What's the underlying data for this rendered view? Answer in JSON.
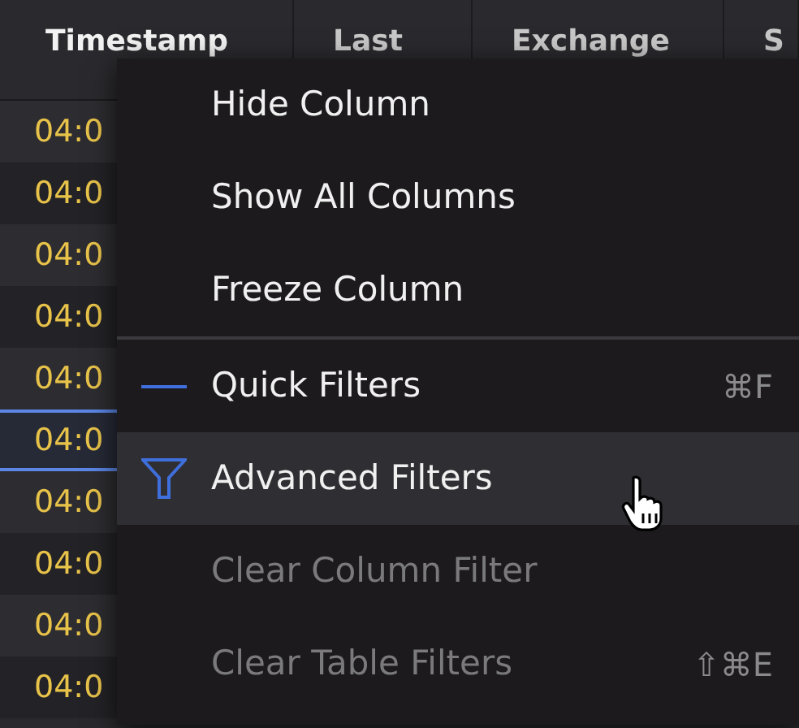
{
  "table": {
    "columns": [
      "Timestamp",
      "Last",
      "Exchange",
      "S"
    ],
    "rows": [
      {
        "time": "04:0",
        "selected": false
      },
      {
        "time": "04:0",
        "selected": false
      },
      {
        "time": "04:0",
        "selected": false
      },
      {
        "time": "04:0",
        "selected": false
      },
      {
        "time": "04:0",
        "selected": false
      },
      {
        "time": "04:0",
        "selected": true
      },
      {
        "time": "04:0",
        "selected": false
      },
      {
        "time": "04:0",
        "selected": false
      },
      {
        "time": "04:0",
        "selected": false
      },
      {
        "time": "04:0",
        "selected": false
      }
    ]
  },
  "context_menu": {
    "groups": [
      [
        {
          "label": "Hide Column",
          "kind": "plain",
          "disabled": false,
          "highlighted": false
        },
        {
          "label": "Show All Columns",
          "kind": "plain",
          "disabled": false,
          "highlighted": false
        },
        {
          "label": "Freeze Column",
          "kind": "plain",
          "disabled": false,
          "highlighted": false
        }
      ],
      [
        {
          "label": "Quick Filters",
          "kind": "dash",
          "shortcut": "⌘F",
          "disabled": false,
          "highlighted": false
        },
        {
          "label": "Advanced Filters",
          "kind": "funnel",
          "disabled": false,
          "highlighted": true
        },
        {
          "label": "Clear Column Filter",
          "kind": "plain",
          "disabled": true,
          "highlighted": false
        },
        {
          "label": "Clear Table Filters",
          "kind": "plain",
          "shortcut": "⇧⌘E",
          "disabled": true,
          "highlighted": false
        }
      ]
    ]
  }
}
